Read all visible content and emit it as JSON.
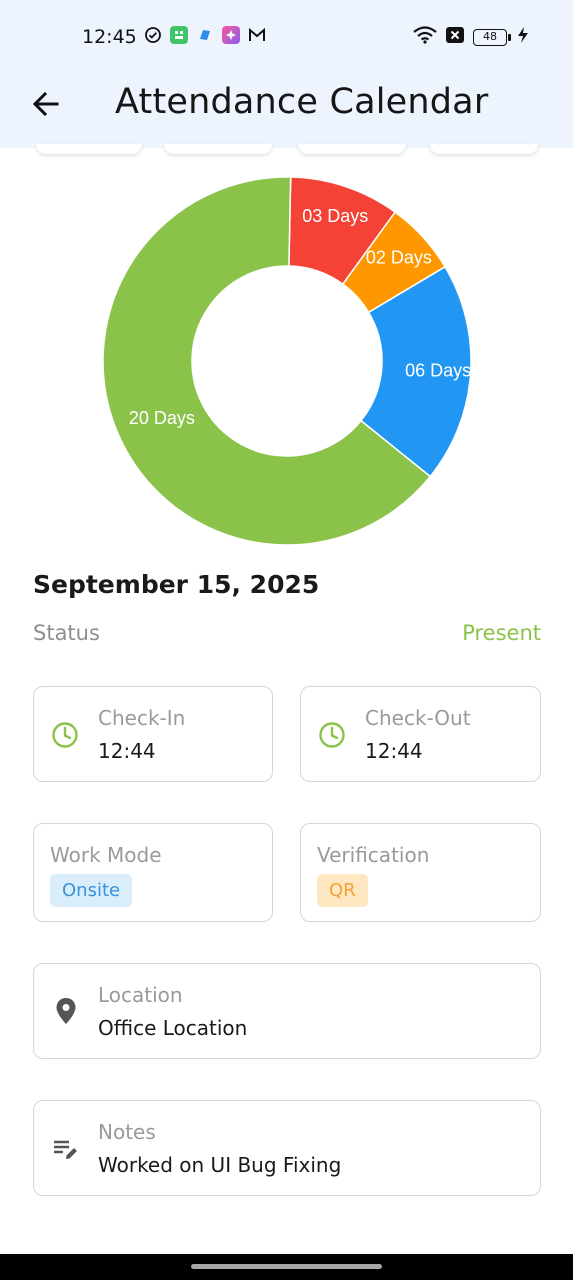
{
  "status_bar": {
    "time": "12:45",
    "battery": "48",
    "left_icons": [
      "check-circle-icon",
      "app-green-icon",
      "app-blue-icon",
      "app-pink-icon",
      "gmail-icon"
    ],
    "right_icons": [
      "wifi-icon",
      "x-box-icon",
      "battery-icon",
      "charging-icon"
    ]
  },
  "app_bar": {
    "title": "Attendance Calendar",
    "background": "#edf4fd"
  },
  "chart_data": {
    "type": "pie",
    "donut": true,
    "slices": [
      {
        "label": "03 Days",
        "value": 3,
        "color": "#f44336"
      },
      {
        "label": "02 Days",
        "value": 2,
        "color": "#ff9800"
      },
      {
        "label": "06 Days",
        "value": 6,
        "color": "#2196f3"
      },
      {
        "label": "20 Days",
        "value": 20,
        "color": "#8bc34a"
      }
    ]
  },
  "details": {
    "date": "September 15, 2025",
    "status_label": "Status",
    "status_value": "Present",
    "status_color": "#8bc34a",
    "check_in": {
      "label": "Check-In",
      "value": "12:44",
      "icon": "clock-icon"
    },
    "check_out": {
      "label": "Check-Out",
      "value": "12:44",
      "icon": "clock-icon"
    },
    "work_mode": {
      "label": "Work Mode",
      "value": "Onsite",
      "chip_bg": "#d9edfb",
      "chip_color": "#3a94dc"
    },
    "verification": {
      "label": "Verification",
      "value": "QR",
      "chip_bg": "#ffe7c2",
      "chip_color": "#f2a233"
    },
    "location": {
      "label": "Location",
      "value": "Office Location",
      "icon": "location-pin-icon"
    },
    "notes": {
      "label": "Notes",
      "value": "Worked on UI Bug Fixing",
      "icon": "notes-edit-icon"
    }
  }
}
